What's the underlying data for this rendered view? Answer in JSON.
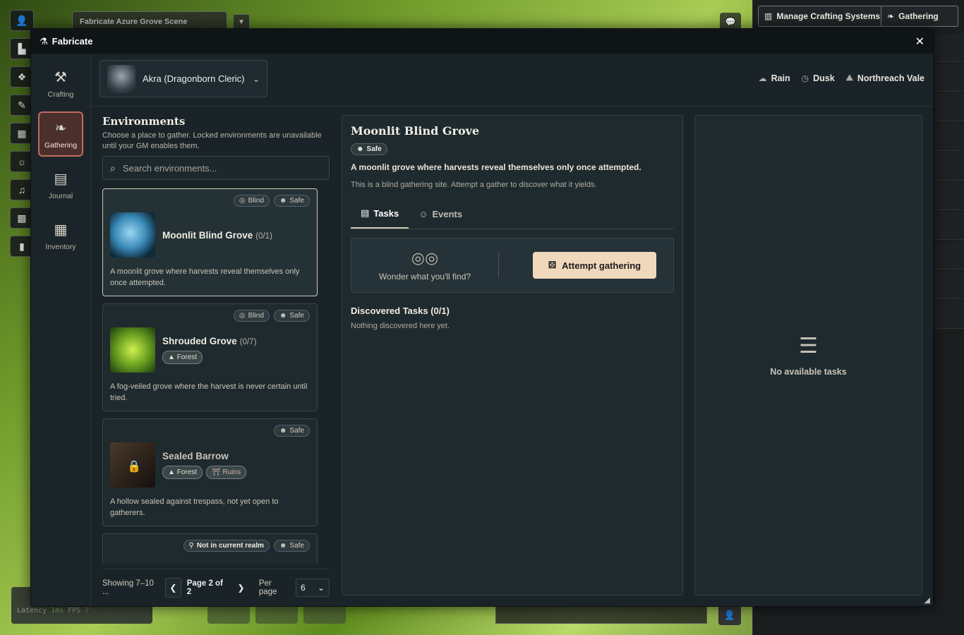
{
  "background": {
    "scene_tab": "Fabricate Azure Grove Scene",
    "top_buttons": [
      {
        "label": "Manage Crafting Systems",
        "icon": "book-icon"
      },
      {
        "label": "Gathering",
        "icon": "leaf-icon"
      }
    ],
    "status_latency_label": "Latency",
    "status_latency": "1ms",
    "status_fps_label": "FPS",
    "status_fps": "?"
  },
  "window": {
    "title": "Fabricate",
    "close": "✕"
  },
  "nav": [
    {
      "id": "crafting",
      "label": "Crafting",
      "icon": "hammer-icon",
      "glyph": "⚒",
      "active": false
    },
    {
      "id": "gathering",
      "label": "Gathering",
      "icon": "leaf-icon",
      "glyph": "❧",
      "active": true
    },
    {
      "id": "journal",
      "label": "Journal",
      "icon": "book-open-icon",
      "glyph": "▤",
      "active": false
    },
    {
      "id": "inventory",
      "label": "Inventory",
      "icon": "boxes-icon",
      "glyph": "▦",
      "active": false
    }
  ],
  "actor": {
    "name": "Akra (Dragonborn Cleric)",
    "caret": "⌄"
  },
  "conditions": [
    {
      "label": "Rain",
      "icon": "cloud-rain-icon",
      "glyph": "☁"
    },
    {
      "label": "Dusk",
      "icon": "clock-icon",
      "glyph": "◷"
    },
    {
      "label": "Northreach Vale",
      "icon": "map-icon",
      "glyph": "⛰"
    }
  ],
  "environments": {
    "title": "Environments",
    "description": "Choose a place to gather. Locked environments are unavailable until your GM enables them.",
    "search_placeholder": "Search environments...",
    "cards": [
      {
        "name": "Moonlit Blind Grove",
        "count": "(0/1)",
        "badges": [
          "Blind",
          "Safe"
        ],
        "tags": [],
        "text": "A moonlit grove where harvests reveal themselves only once attempted.",
        "image": "wolf",
        "selected": true,
        "locked": false
      },
      {
        "name": "Shrouded Grove",
        "count": "(0/7)",
        "badges": [
          "Blind",
          "Safe"
        ],
        "tags": [
          "Forest"
        ],
        "text": "A fog-veiled grove where the harvest is never certain until tried.",
        "image": "tree",
        "selected": false,
        "locked": false
      },
      {
        "name": "Sealed Barrow",
        "count": "",
        "badges": [
          "Safe"
        ],
        "tags": [
          "Forest",
          "Ruins"
        ],
        "text": "A hollow sealed against trespass, not yet open to gatherers.",
        "image": "barrow",
        "selected": false,
        "locked": true
      },
      {
        "name": "",
        "count": "",
        "badges": [
          "Not in current realm",
          "Safe"
        ],
        "tags": [],
        "text": "",
        "image": "",
        "selected": false,
        "locked": false
      }
    ],
    "pager": {
      "showing": "Showing 7–10 ...",
      "page": "Page 2 of 2",
      "per_page_label": "Per page",
      "per_page_value": "6"
    }
  },
  "detail": {
    "title": "Moonlit Blind Grove",
    "badge": "Safe",
    "summary": "A moonlit grove where harvests reveal themselves only once attempted.",
    "hint": "This is a blind gathering site. Attempt a gather to discover what it yields.",
    "tabs": [
      {
        "label": "Tasks",
        "icon": "clipboard-icon",
        "active": true
      },
      {
        "label": "Events",
        "icon": "masks-icon",
        "active": false
      }
    ],
    "wonder": "Wonder what you'll find?",
    "attempt": "Attempt gathering",
    "discovered_title": "Discovered Tasks (0/1)",
    "discovered_empty": "Nothing discovered here yet."
  },
  "tasks": {
    "empty": "No available tasks"
  }
}
